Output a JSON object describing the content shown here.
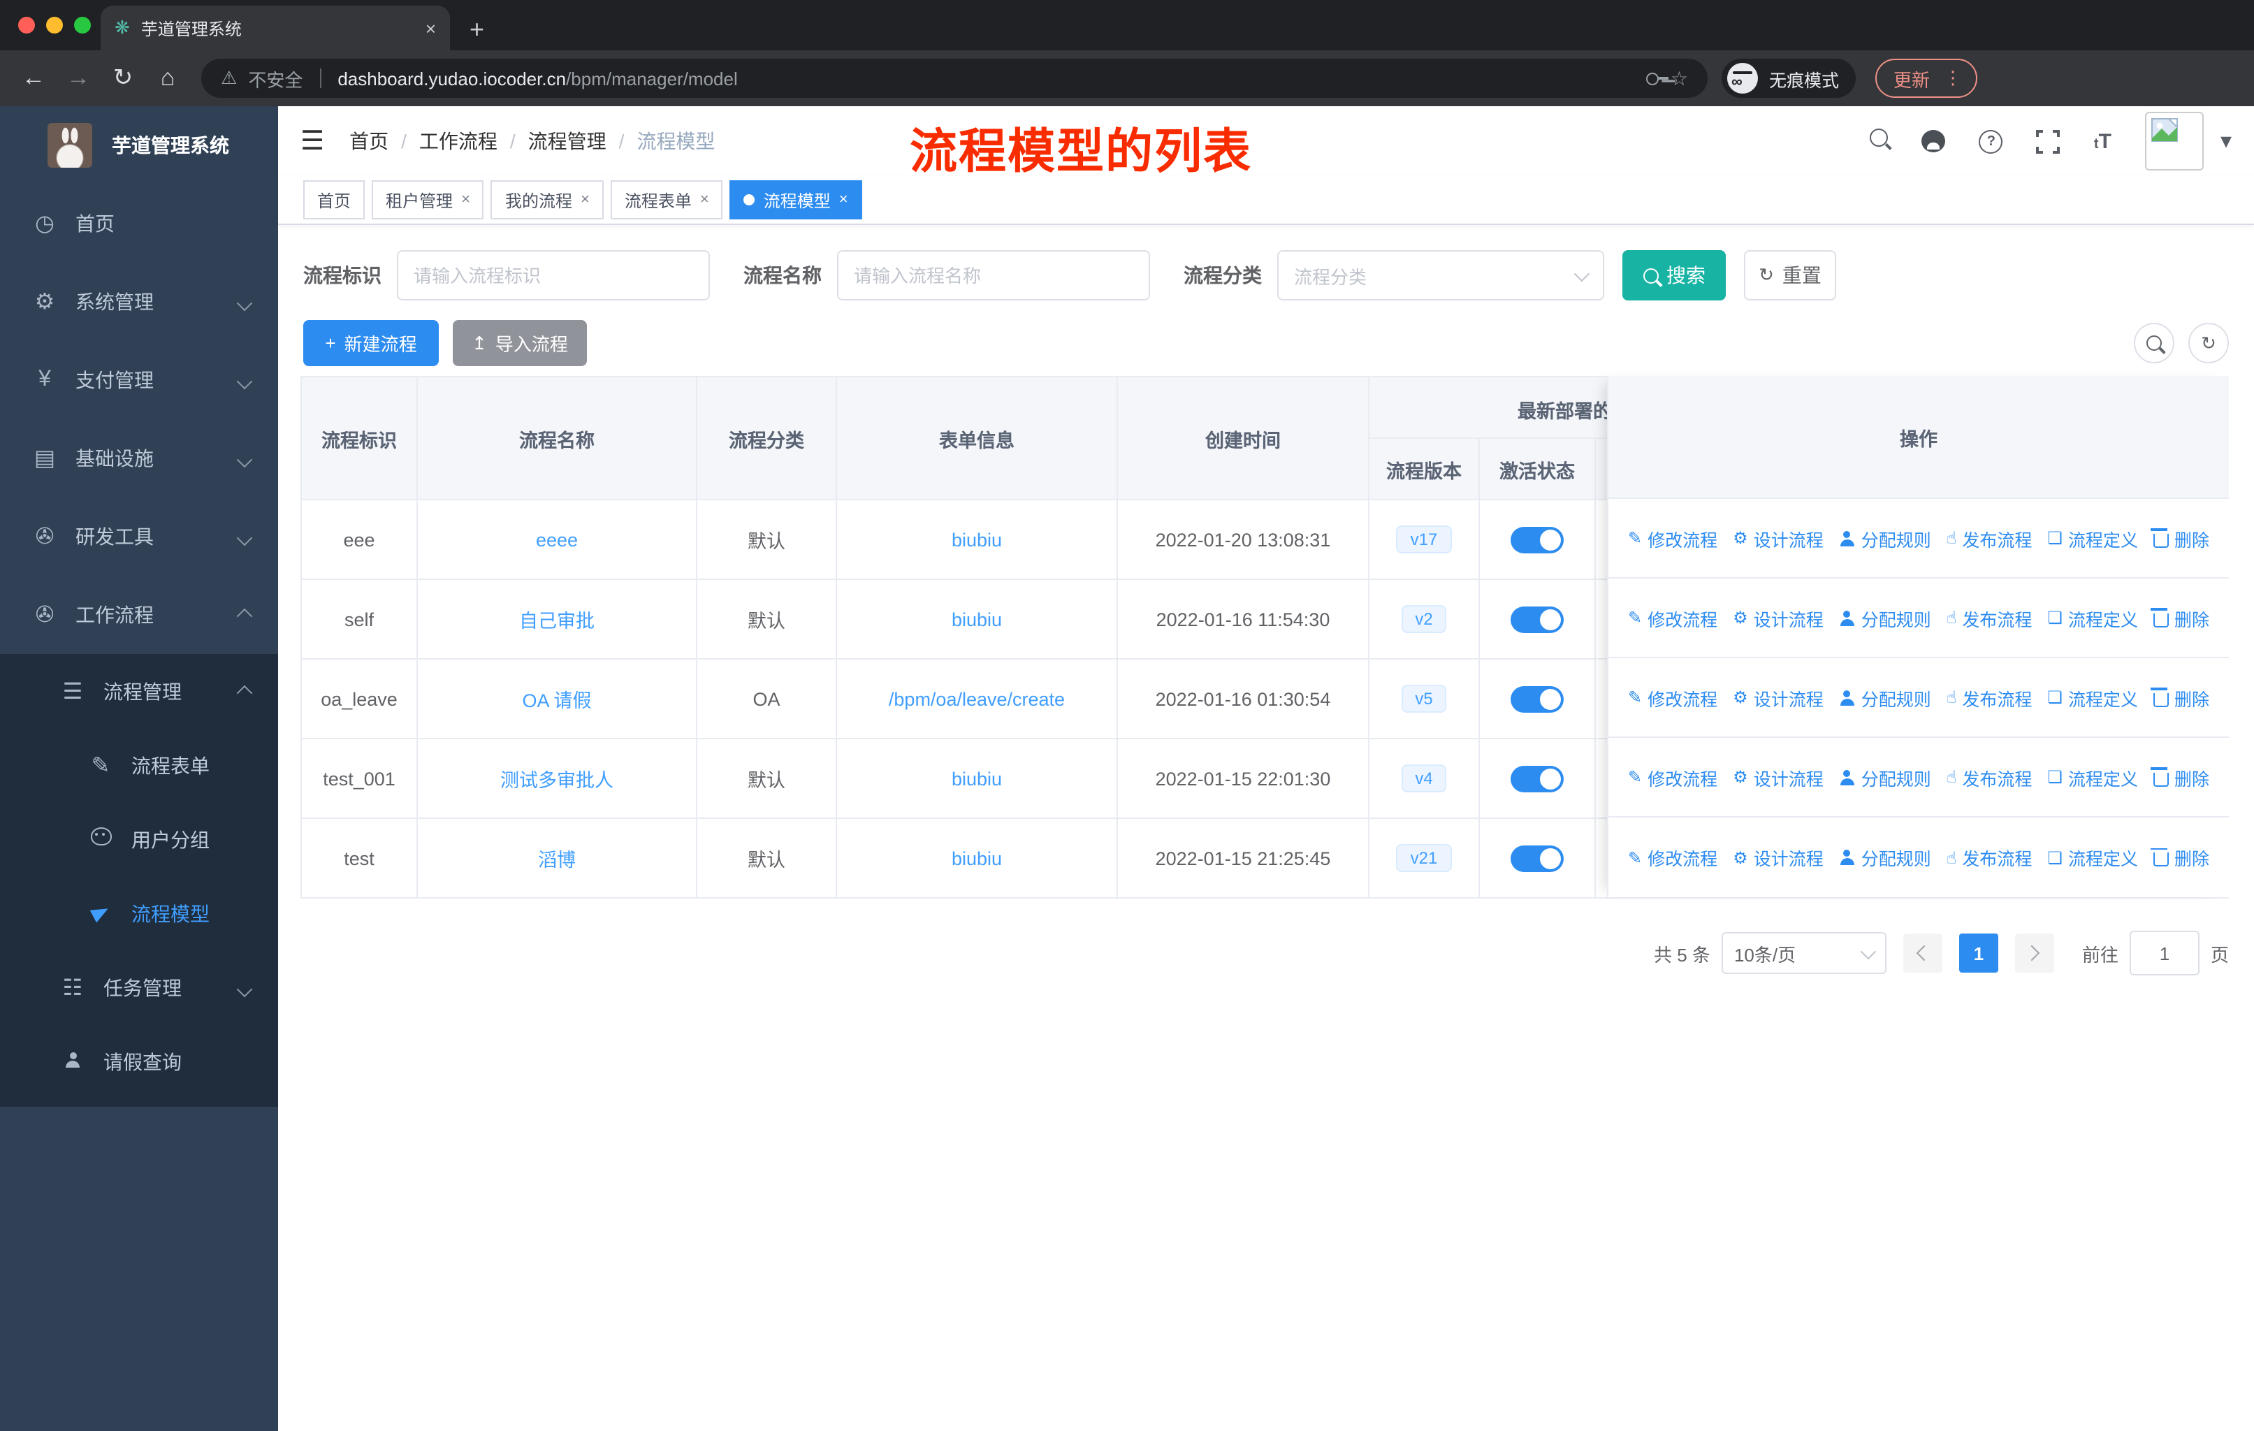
{
  "colors": {
    "accent": "#2d8cf0",
    "link": "#409eff",
    "sidebar_bg": "#304156",
    "submenu_bg": "#1f2d3d",
    "teal": "#17b3a3",
    "annotation_red": "#f92c00",
    "tag_active": "#2d8cf0"
  },
  "browser": {
    "tab_title": "芋道管理系统",
    "close": "×",
    "new_tab": "+",
    "not_secure": "不安全",
    "url_domain": "dashboard.yudao.iocoder.cn",
    "url_path": "/bpm/manager/model",
    "incognito": "无痕模式",
    "update": "更新",
    "menu_dots": "⋮",
    "back": "←",
    "forward": "→",
    "reload": "↻",
    "home": "⌂",
    "warn": "⚠",
    "star": "☆"
  },
  "sidebar": {
    "brand": "芋道管理系统",
    "items": [
      {
        "label": "首页",
        "icon": "dashboard-icon",
        "glyph": "◷"
      },
      {
        "label": "系统管理",
        "icon": "gear-icon",
        "glyph": "⚙",
        "expandable": true
      },
      {
        "label": "支付管理",
        "icon": "yen-icon",
        "glyph": "¥",
        "expandable": true
      },
      {
        "label": "基础设施",
        "icon": "infrastructure-icon",
        "glyph": "▤",
        "expandable": true
      },
      {
        "label": "研发工具",
        "icon": "toolbox-icon",
        "glyph": "✇",
        "expandable": true
      },
      {
        "label": "工作流程",
        "icon": "toolbox-icon",
        "glyph": "✇",
        "expandable": true,
        "expanded": true
      }
    ],
    "submenu": [
      {
        "label": "流程管理",
        "glyph": "☰",
        "expanded": true
      },
      {
        "label": "流程表单",
        "glyph": "✎"
      },
      {
        "label": "用户分组"
      },
      {
        "label": "流程模型",
        "active": true
      },
      {
        "label": "任务管理",
        "glyph": "☷",
        "expandable": true
      },
      {
        "label": "请假查询"
      }
    ]
  },
  "navbar": {
    "breadcrumb": [
      "首页",
      "工作流程",
      "流程管理",
      "流程模型"
    ],
    "separator": "/",
    "annotation": "流程模型的列表",
    "font_size_icon": "tT",
    "help_glyph": "?"
  },
  "tags": [
    {
      "label": "首页",
      "closable": false,
      "active": false
    },
    {
      "label": "租户管理",
      "closable": true,
      "active": false
    },
    {
      "label": "我的流程",
      "closable": true,
      "active": false
    },
    {
      "label": "流程表单",
      "closable": true,
      "active": false
    },
    {
      "label": "流程模型",
      "closable": true,
      "active": true
    }
  ],
  "close_glyph": "×",
  "filter": {
    "id_label": "流程标识",
    "id_placeholder": "请输入流程标识",
    "name_label": "流程名称",
    "name_placeholder": "请输入流程名称",
    "category_label": "流程分类",
    "category_placeholder": "流程分类",
    "search": "搜索",
    "reset": "重置",
    "reset_glyph": "↻"
  },
  "toolbar": {
    "create": "新建流程",
    "create_glyph": "+",
    "import": "导入流程",
    "import_glyph": "↥"
  },
  "table": {
    "headers": {
      "id": "流程标识",
      "name": "流程名称",
      "category": "流程分类",
      "form": "表单信息",
      "created": "创建时间",
      "deploy_group": "最新部署的",
      "version": "流程版本",
      "active": "激活状态",
      "ops": "操作"
    },
    "action_labels": [
      "修改流程",
      "设计流程",
      "分配规则",
      "发布流程",
      "流程定义",
      "删除"
    ],
    "action_glyphs": {
      "edit": "✎",
      "design": "⚙",
      "publish": "☝",
      "definition": "❏"
    },
    "rows": [
      {
        "id": "eee",
        "name": "eeee",
        "category": "默认",
        "form": "biubiu",
        "created": "2022-01-20 13:08:31",
        "version": "v17",
        "active": true
      },
      {
        "id": "self",
        "name": "自己审批",
        "category": "默认",
        "form": "biubiu",
        "created": "2022-01-16 11:54:30",
        "version": "v2",
        "active": true
      },
      {
        "id": "oa_leave",
        "name": "OA 请假",
        "category": "OA",
        "form": "/bpm/oa/leave/create",
        "created": "2022-01-16 01:30:54",
        "version": "v5",
        "active": true
      },
      {
        "id": "test_001",
        "name": "测试多审批人",
        "category": "默认",
        "form": "biubiu",
        "created": "2022-01-15 22:01:30",
        "version": "v4",
        "active": true
      },
      {
        "id": "test",
        "name": "滔博",
        "category": "默认",
        "form": "biubiu",
        "created": "2022-01-15 21:25:45",
        "version": "v21",
        "active": true
      }
    ]
  },
  "pagination": {
    "total": "共 5 条",
    "per_page": "10条/页",
    "page": "1",
    "goto": "前往",
    "page_suffix": "页",
    "goto_value": "1"
  }
}
